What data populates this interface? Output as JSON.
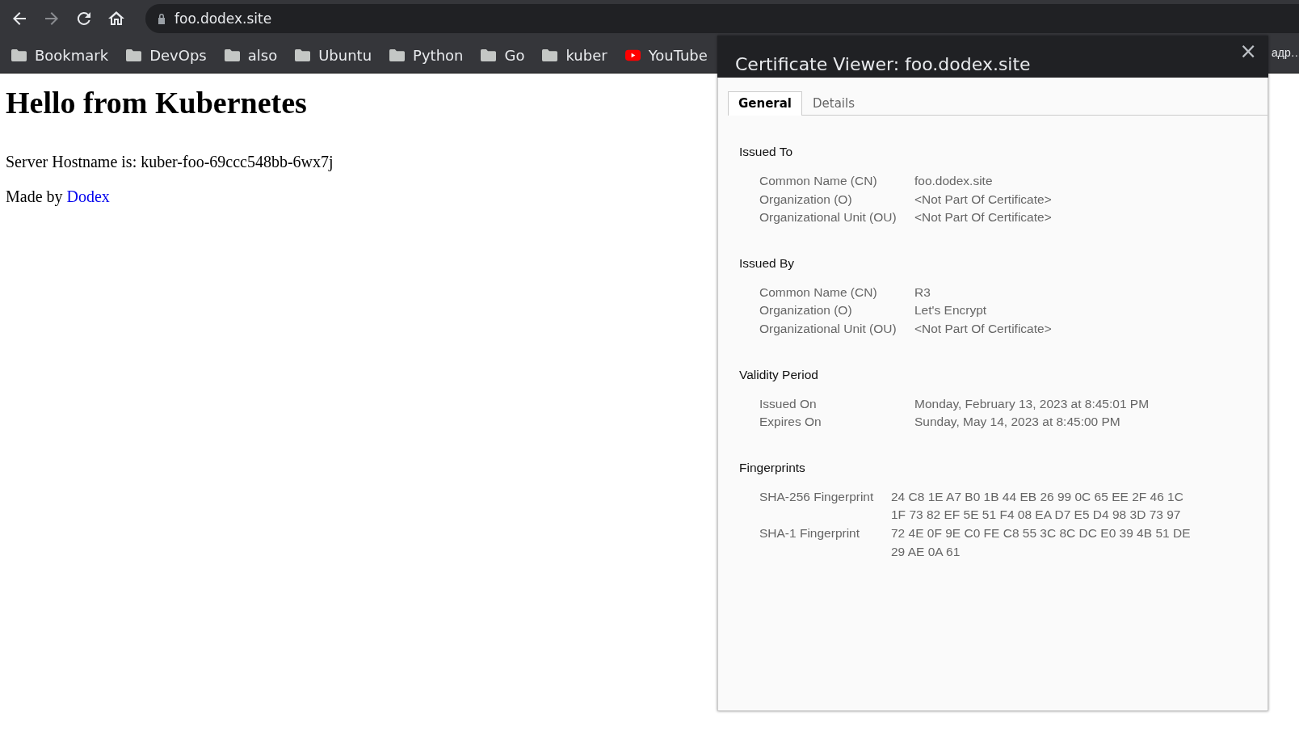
{
  "toolbar": {
    "url": "foo.dodex.site"
  },
  "bookmarks": [
    {
      "label": "Bookmark",
      "kind": "folder"
    },
    {
      "label": "DevOps",
      "kind": "folder"
    },
    {
      "label": "also",
      "kind": "folder"
    },
    {
      "label": "Ubuntu",
      "kind": "folder"
    },
    {
      "label": "Python",
      "kind": "folder"
    },
    {
      "label": "Go",
      "kind": "folder"
    },
    {
      "label": "kuber",
      "kind": "folder"
    },
    {
      "label": "YouTube",
      "kind": "video"
    }
  ],
  "bookmarks_overflow": "адр…",
  "page": {
    "heading": "Hello from Kubernetes",
    "hostname": "Server Hostname is: kuber-foo-69ccc548bb-6wx7j",
    "made_by": "Made by",
    "link": "Dodex"
  },
  "dialog": {
    "title": "Certificate Viewer: foo.dodex.site",
    "close": "×",
    "tabs": [
      {
        "label": "General",
        "selected": true
      },
      {
        "label": "Details",
        "selected": false
      }
    ],
    "sections": [
      {
        "heading": "Issued To",
        "kind": "fields",
        "rows": [
          {
            "label": "Common Name (CN)",
            "value": [
              "foo.dodex.site"
            ]
          },
          {
            "label": "Organization (O)",
            "value": [
              "<Not Part Of Certificate>"
            ]
          },
          {
            "label": "Organizational Unit (OU)",
            "value": [
              "<Not Part Of Certificate>"
            ]
          }
        ]
      },
      {
        "heading": "Issued By",
        "kind": "fields",
        "rows": [
          {
            "label": "Common Name (CN)",
            "value": [
              "R3"
            ]
          },
          {
            "label": "Organization (O)",
            "value": [
              "Let's Encrypt"
            ]
          },
          {
            "label": "Organizational Unit (OU)",
            "value": [
              "<Not Part Of Certificate>"
            ]
          }
        ]
      },
      {
        "heading": "Validity Period",
        "kind": "fields",
        "rows": [
          {
            "label": "Issued On",
            "value": [
              "Monday, February 13, 2023 at 8:45:01 PM"
            ]
          },
          {
            "label": "Expires On",
            "value": [
              "Sunday, May 14, 2023 at 8:45:00 PM"
            ]
          }
        ]
      },
      {
        "heading": "Fingerprints",
        "kind": "fingerprints",
        "rows": [
          {
            "label": "SHA-256 Fingerprint",
            "value": [
              "24 C8 1E A7 B0 1B 44 EB 26 99 0C 65 EE 2F 46 1C",
              "1F 73 82 EF 5E 51 F4 08 EA D7 E5 D4 98 3D 73 97"
            ]
          },
          {
            "label": "SHA-1 Fingerprint",
            "value": [
              "72 4E 0F 9E C0 FE C8 55 3C 8C DC E0 39 4B 51 DE",
              "29 AE 0A 61"
            ]
          }
        ]
      }
    ]
  }
}
